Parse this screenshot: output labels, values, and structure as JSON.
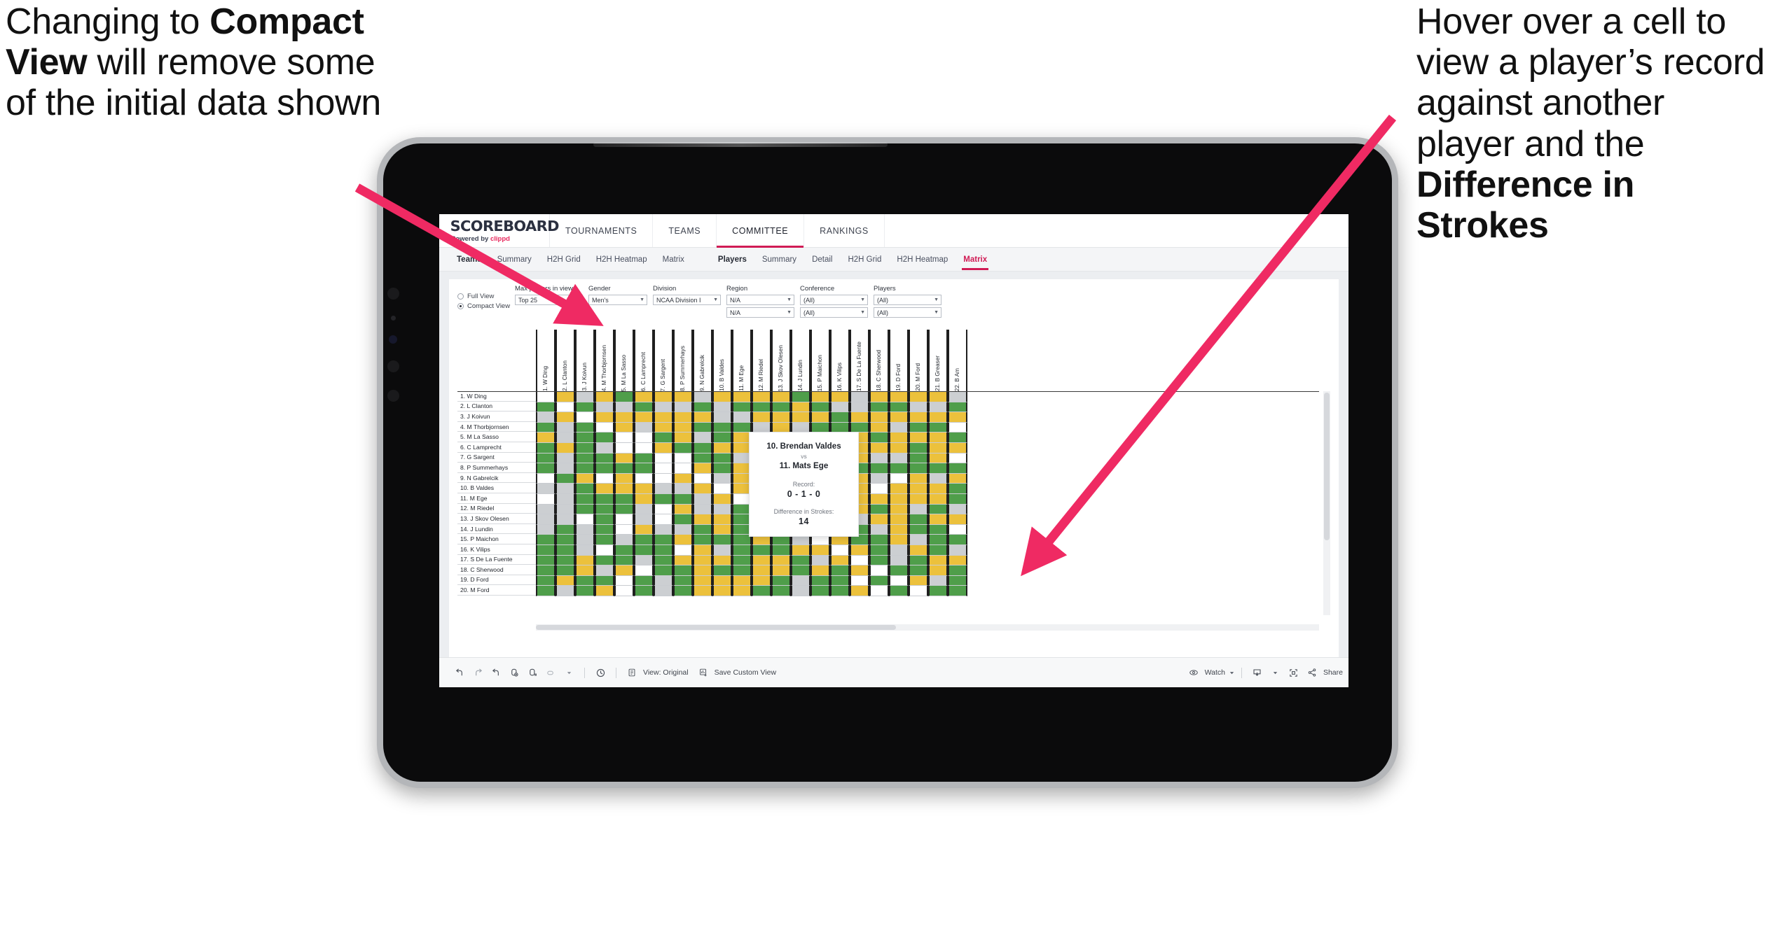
{
  "annotations": {
    "left": {
      "pre": "Changing to ",
      "bold": "Compact View",
      "post": " will remove some of the initial data shown"
    },
    "right": {
      "pre": "Hover over a cell to view a player’s record against another player and the ",
      "bold": "Difference in Strokes",
      "post": ""
    }
  },
  "app": {
    "logo": {
      "word": "SCOREBOARD",
      "sub_pre": "Powered by ",
      "sub_brand": "clippd"
    },
    "topnav": [
      {
        "label": "TOURNAMENTS",
        "active": false
      },
      {
        "label": "TEAMS",
        "active": false
      },
      {
        "label": "COMMITTEE",
        "active": true
      },
      {
        "label": "RANKINGS",
        "active": false
      }
    ],
    "subnav_teams": [
      {
        "label": "Teams",
        "bold": true,
        "selected": false
      },
      {
        "label": "Summary",
        "bold": false,
        "selected": false
      },
      {
        "label": "H2H Grid",
        "bold": false,
        "selected": false
      },
      {
        "label": "H2H Heatmap",
        "bold": false,
        "selected": false
      },
      {
        "label": "Matrix",
        "bold": false,
        "selected": false
      }
    ],
    "subnav_players": [
      {
        "label": "Players",
        "bold": true,
        "selected": false
      },
      {
        "label": "Summary",
        "bold": false,
        "selected": false
      },
      {
        "label": "Detail",
        "bold": false,
        "selected": false
      },
      {
        "label": "H2H Grid",
        "bold": false,
        "selected": false
      },
      {
        "label": "H2H Heatmap",
        "bold": false,
        "selected": false
      },
      {
        "label": "Matrix",
        "bold": false,
        "selected": true
      }
    ]
  },
  "filters": {
    "view_mode": [
      {
        "label": "Full View",
        "selected": false
      },
      {
        "label": "Compact View",
        "selected": true
      }
    ],
    "controls": [
      {
        "label": "Max players in view",
        "values": [
          "Top 25"
        ],
        "width": "w-mp"
      },
      {
        "label": "Gender",
        "values": [
          "Men's"
        ],
        "width": "w-gd"
      },
      {
        "label": "Division",
        "values": [
          "NCAA Division I"
        ],
        "width": "w-dv"
      },
      {
        "label": "Region",
        "values": [
          "N/A",
          "N/A"
        ],
        "width": "w-rg"
      },
      {
        "label": "Conference",
        "values": [
          "(All)",
          "(All)"
        ],
        "width": "w-cf"
      },
      {
        "label": "Players",
        "values": [
          "(All)",
          "(All)"
        ],
        "width": "w-pl"
      }
    ]
  },
  "matrix": {
    "row_labels": [
      "1. W Ding",
      "2. L Clanton",
      "3. J Koivun",
      "4. M Thorbjornsen",
      "5. M La Sasso",
      "6. C Lamprecht",
      "7. G Sargent",
      "8. P Summerhays",
      "9. N Gabrelcik",
      "10. B Valdes",
      "11. M Ege",
      "12. M Riedel",
      "13. J Skov Olesen",
      "14. J Lundin",
      "15. P Maichon",
      "16. K Vilips",
      "17. S De La Fuente",
      "18. C Sherwood",
      "19. D Ford",
      "20. M Ford"
    ],
    "col_labels": [
      "1. W Ding",
      "2. L Clanton",
      "3. J Koivun",
      "4. M Thorbjornsen",
      "5. M La Sasso",
      "6. C Lamprecht",
      "7. G Sargent",
      "8. P Summerhays",
      "9. N Gabrelcik",
      "10. B Valdes",
      "11. M Ege",
      "12. M Riedel",
      "13. J Skov Olesen",
      "14. J Lundin",
      "15. P Maichon",
      "16. K Vilips",
      "17. S De La Fuente",
      "18. C Sherwood",
      "19. D Ford",
      "20. M Ford",
      "21. B Greaser",
      "22. B Am"
    ],
    "legend": {
      "win": "#4f9e4a",
      "loss": "#ecc13c",
      "tie": "#cccfd2",
      "none": "#ffffff"
    },
    "cells": [
      [
        "w",
        "y",
        "a",
        "y",
        "g",
        "y",
        "y",
        "y",
        "a",
        "y",
        "y",
        "y",
        "y",
        "g",
        "y",
        "y",
        "a",
        "y",
        "y",
        "y",
        "y",
        "a"
      ],
      [
        "g",
        "w",
        "g",
        "a",
        "a",
        "g",
        "a",
        "a",
        "g",
        "a",
        "g",
        "g",
        "g",
        "y",
        "g",
        "a",
        "a",
        "g",
        "g",
        "a",
        "a",
        "g"
      ],
      [
        "a",
        "y",
        "w",
        "y",
        "y",
        "y",
        "y",
        "y",
        "y",
        "a",
        "a",
        "y",
        "y",
        "y",
        "y",
        "g",
        "y",
        "y",
        "y",
        "y",
        "y",
        "y"
      ],
      [
        "g",
        "a",
        "g",
        "w",
        "y",
        "a",
        "y",
        "y",
        "g",
        "g",
        "g",
        "a",
        "y",
        "a",
        "g",
        "g",
        "g",
        "y",
        "a",
        "g",
        "g",
        "w"
      ],
      [
        "y",
        "a",
        "g",
        "g",
        "w",
        "w",
        "g",
        "y",
        "a",
        "g",
        "y",
        "y",
        "a",
        "y",
        "g",
        "g",
        "y",
        "g",
        "y",
        "y",
        "y",
        "g"
      ],
      [
        "g",
        "y",
        "g",
        "a",
        "w",
        "w",
        "y",
        "g",
        "g",
        "y",
        "y",
        "a",
        "y",
        "a",
        "y",
        "y",
        "y",
        "y",
        "y",
        "g",
        "y",
        "y"
      ],
      [
        "g",
        "a",
        "g",
        "g",
        "y",
        "g",
        "w",
        "w",
        "g",
        "g",
        "a",
        "g",
        "a",
        "y",
        "a",
        "g",
        "y",
        "a",
        "a",
        "g",
        "y",
        "w"
      ],
      [
        "g",
        "a",
        "g",
        "g",
        "g",
        "g",
        "w",
        "w",
        "y",
        "g",
        "y",
        "g",
        "a",
        "y",
        "a",
        "g",
        "g",
        "g",
        "g",
        "g",
        "g",
        "g"
      ],
      [
        "w",
        "g",
        "y",
        "w",
        "y",
        "w",
        "w",
        "y",
        "w",
        "a",
        "y",
        "w",
        "w",
        "g",
        "y",
        "a",
        "y",
        "a",
        "w",
        "y",
        "a",
        "y"
      ],
      [
        "a",
        "a",
        "g",
        "y",
        "y",
        "y",
        "a",
        "a",
        "y",
        "w",
        "y",
        "y",
        "g",
        "g",
        "w",
        "y",
        "y",
        "w",
        "y",
        "y",
        "y",
        "g"
      ],
      [
        "w",
        "a",
        "g",
        "g",
        "g",
        "y",
        "g",
        "g",
        "a",
        "y",
        "w",
        "y",
        "a",
        "g",
        "y",
        "a",
        "y",
        "y",
        "y",
        "y",
        "y",
        "g"
      ],
      [
        "a",
        "a",
        "g",
        "g",
        "g",
        "a",
        "w",
        "y",
        "a",
        "a",
        "g",
        "w",
        "y",
        "a",
        "y",
        "y",
        "y",
        "g",
        "y",
        "a",
        "g",
        "a"
      ],
      [
        "a",
        "a",
        "w",
        "g",
        "w",
        "a",
        "w",
        "g",
        "y",
        "y",
        "g",
        "y",
        "w",
        "a",
        "y",
        "g",
        "a",
        "y",
        "y",
        "g",
        "y",
        "y"
      ],
      [
        "a",
        "g",
        "a",
        "g",
        "w",
        "y",
        "a",
        "a",
        "g",
        "y",
        "g",
        "a",
        "g",
        "w",
        "y",
        "y",
        "g",
        "a",
        "y",
        "g",
        "g",
        "w"
      ],
      [
        "g",
        "g",
        "a",
        "g",
        "a",
        "g",
        "g",
        "y",
        "g",
        "g",
        "g",
        "y",
        "g",
        "a",
        "w",
        "y",
        "g",
        "g",
        "y",
        "a",
        "g",
        "g"
      ],
      [
        "g",
        "g",
        "a",
        "w",
        "g",
        "g",
        "g",
        "w",
        "y",
        "a",
        "g",
        "g",
        "g",
        "y",
        "y",
        "w",
        "y",
        "g",
        "a",
        "y",
        "g",
        "a"
      ],
      [
        "g",
        "g",
        "y",
        "g",
        "g",
        "a",
        "g",
        "y",
        "y",
        "y",
        "g",
        "y",
        "y",
        "g",
        "a",
        "y",
        "w",
        "g",
        "a",
        "g",
        "y",
        "y"
      ],
      [
        "g",
        "g",
        "y",
        "a",
        "y",
        "w",
        "g",
        "g",
        "y",
        "g",
        "g",
        "y",
        "y",
        "g",
        "y",
        "g",
        "y",
        "w",
        "g",
        "g",
        "y",
        "g"
      ],
      [
        "g",
        "y",
        "g",
        "g",
        "w",
        "g",
        "a",
        "g",
        "y",
        "y",
        "y",
        "y",
        "g",
        "a",
        "g",
        "g",
        "w",
        "g",
        "w",
        "y",
        "a",
        "g"
      ],
      [
        "g",
        "a",
        "g",
        "y",
        "w",
        "g",
        "a",
        "g",
        "y",
        "y",
        "y",
        "g",
        "g",
        "a",
        "g",
        "g",
        "y",
        "w",
        "g",
        "w",
        "g",
        "g"
      ]
    ]
  },
  "tooltip": {
    "player_a": "10. Brendan Valdes",
    "vs": "vs",
    "player_b": "11. Mats Ege",
    "record_label": "Record:",
    "record_value": "0 - 1 - 0",
    "diff_label": "Difference in Strokes:",
    "diff_value": "14"
  },
  "toolbar": {
    "view_label": "View: Original",
    "save_label": "Save Custom View",
    "watch_label": "Watch",
    "share_label": "Share"
  }
}
